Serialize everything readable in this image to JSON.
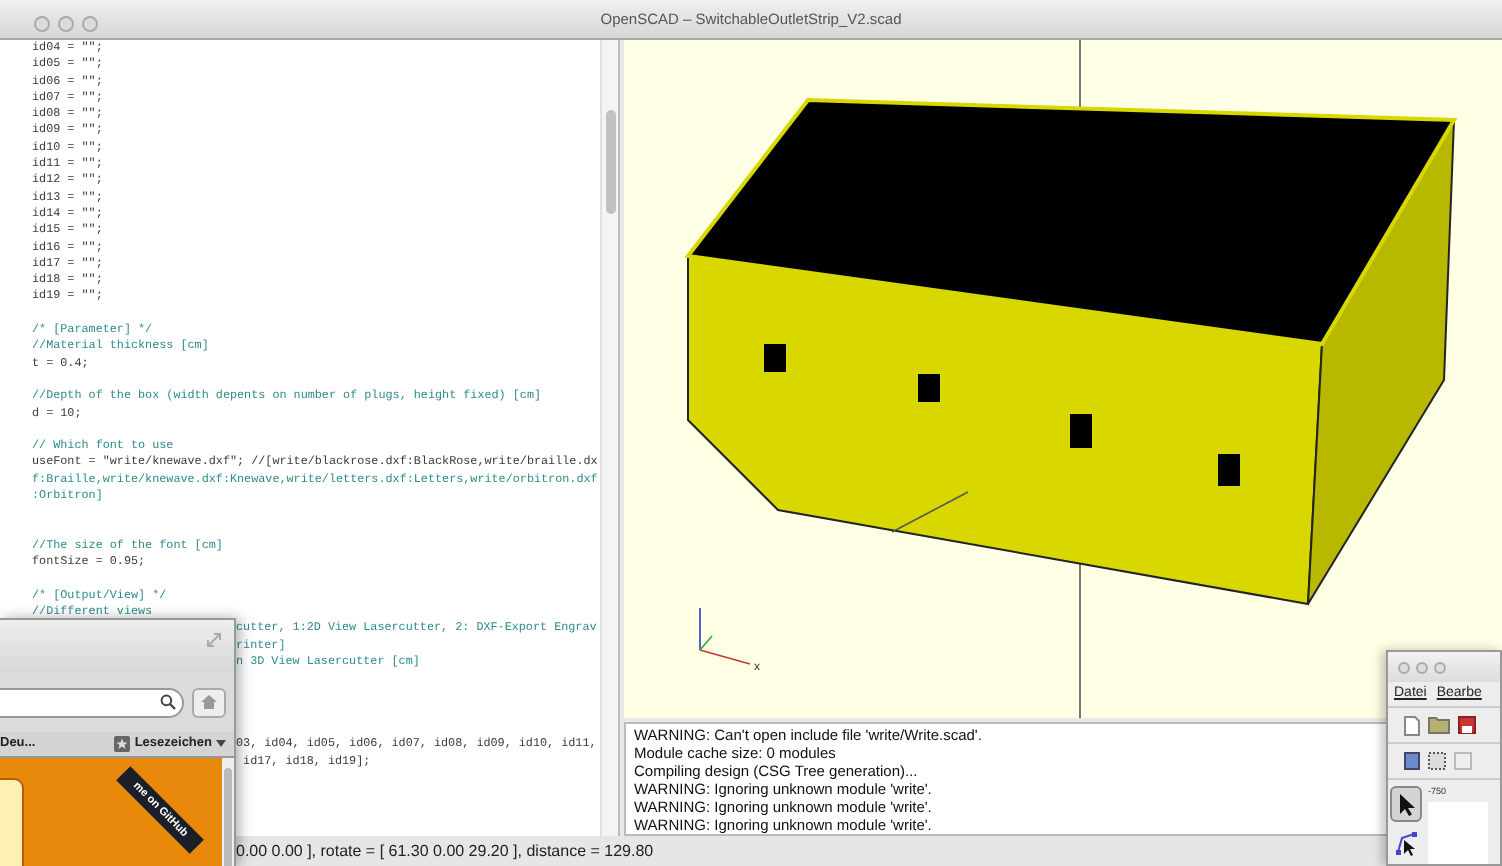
{
  "window": {
    "title": "OpenSCAD – SwitchableOutletStrip_V2.scad"
  },
  "editor": {
    "lines": [
      {
        "kind": "code",
        "text": "id04 = \"\";"
      },
      {
        "kind": "code",
        "text": "id05 = \"\";"
      },
      {
        "kind": "code",
        "text": "id06 = \"\";"
      },
      {
        "kind": "code",
        "text": "id07 = \"\";"
      },
      {
        "kind": "code",
        "text": "id08 = \"\";"
      },
      {
        "kind": "code",
        "text": "id09 = \"\";"
      },
      {
        "kind": "code",
        "text": "id10 = \"\";"
      },
      {
        "kind": "code",
        "text": "id11 = \"\";"
      },
      {
        "kind": "code",
        "text": "id12 = \"\";"
      },
      {
        "kind": "code",
        "text": "id13 = \"\";"
      },
      {
        "kind": "code",
        "text": "id14 = \"\";"
      },
      {
        "kind": "code",
        "text": "id15 = \"\";"
      },
      {
        "kind": "code",
        "text": "id16 = \"\";"
      },
      {
        "kind": "code",
        "text": "id17 = \"\";"
      },
      {
        "kind": "code",
        "text": "id18 = \"\";"
      },
      {
        "kind": "code",
        "text": "id19 = \"\";"
      },
      {
        "kind": "blank"
      },
      {
        "kind": "comment",
        "text": "/* [Parameter] */"
      },
      {
        "kind": "comment",
        "text": "//Material thickness [cm]"
      },
      {
        "kind": "code",
        "text": "t = 0.4;"
      },
      {
        "kind": "blank"
      },
      {
        "kind": "comment",
        "text": "//Depth of the box (width depents on number of plugs, height fixed) [cm]"
      },
      {
        "kind": "code",
        "text": "d = 10;"
      },
      {
        "kind": "blank"
      },
      {
        "kind": "comment",
        "text": "// Which font to use"
      },
      {
        "kind": "code",
        "text": "useFont = \"write/knewave.dxf\"; //[write/blackrose.dxf:BlackRose,write/braille.dx"
      },
      {
        "kind": "comment",
        "text": "f:Braille,write/knewave.dxf:Knewave,write/letters.dxf:Letters,write/orbitron.dxf"
      },
      {
        "kind": "comment",
        "text": ":Orbitron]"
      },
      {
        "kind": "blank"
      },
      {
        "kind": "blank"
      },
      {
        "kind": "comment",
        "text": "//The size of the font [cm]"
      },
      {
        "kind": "code",
        "text": "fontSize = 0.95;"
      },
      {
        "kind": "blank"
      },
      {
        "kind": "comment",
        "text": "/* [Output/View] */"
      },
      {
        "kind": "comment",
        "text": "//Different views"
      },
      {
        "kind": "comment",
        "covered": true,
        "text": "cutter, 1:2D View Lasercutter, 2: DXF-Export Engrav"
      },
      {
        "kind": "comment",
        "covered": true,
        "text": "rinter]"
      },
      {
        "kind": "comment",
        "covered": true,
        "text": "n 3D View Lasercutter [cm]"
      },
      {
        "kind": "blank"
      },
      {
        "kind": "blank"
      },
      {
        "kind": "blank"
      },
      {
        "kind": "blank"
      },
      {
        "kind": "code",
        "covered": true,
        "text": "03, id04, id05, id06, id07, id08, id09, id10, id11,"
      },
      {
        "kind": "code",
        "covered": true,
        "text": " id17, id18, id19];"
      }
    ]
  },
  "viewport": {
    "axis_label": "x"
  },
  "console": {
    "lines": [
      "WARNING: Can't open include file 'write/Write.scad'.",
      "Module cache size: 0 modules",
      "Compiling design (CSG Tree generation)...",
      "WARNING: Ignoring unknown module 'write'.",
      "WARNING: Ignoring unknown module 'write'.",
      "WARNING: Ignoring unknown module 'write'."
    ]
  },
  "status_bar": {
    "text": "0.00 0.00 ], rotate = [ 61.30 0.00 29.20 ], distance = 129.80"
  },
  "browser_window": {
    "bookmark": "Deu...",
    "bookmarks_menu": "Lesezeichen",
    "ribbon": "me on GitHub"
  },
  "inkscape_window": {
    "menu": [
      "Datei",
      "Bearbe"
    ],
    "ruler_label": "-750",
    "tools": [
      {
        "kind": "select",
        "selected": true
      },
      {
        "kind": "node",
        "selected": false
      }
    ]
  }
}
